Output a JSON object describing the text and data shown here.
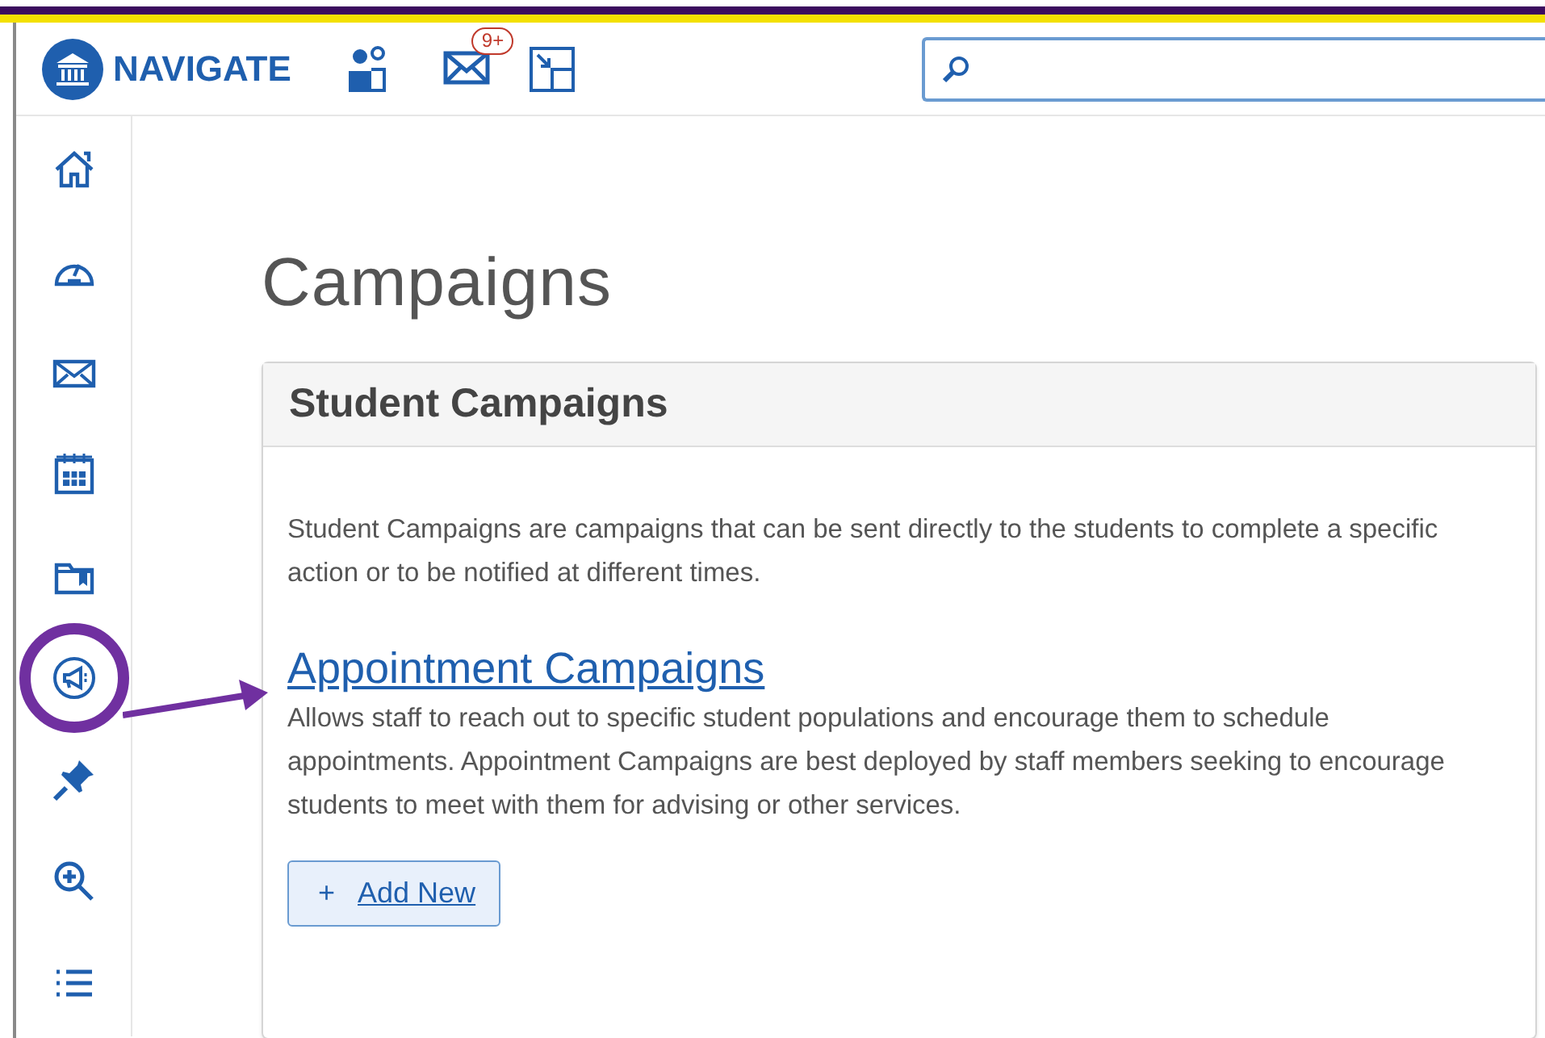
{
  "header": {
    "logo_text": "NAVIGATE",
    "message_badge": "9+"
  },
  "sidebar": {
    "items": [
      {
        "kind": "home",
        "highlighted": false
      },
      {
        "kind": "dashboard",
        "highlighted": false
      },
      {
        "kind": "mail",
        "highlighted": false
      },
      {
        "kind": "calendar",
        "highlighted": false
      },
      {
        "kind": "folder",
        "highlighted": false
      },
      {
        "kind": "campaigns",
        "highlighted": true
      },
      {
        "kind": "pin",
        "highlighted": false
      },
      {
        "kind": "search",
        "highlighted": false
      },
      {
        "kind": "list",
        "highlighted": false
      }
    ]
  },
  "page": {
    "title": "Campaigns",
    "card": {
      "title": "Student Campaigns",
      "intro": "Student Campaigns are campaigns that can be sent directly to the students to complete a specific action or to be notified at different times.",
      "section_link": "Appointment Campaigns",
      "section_text": "Allows staff to reach out to specific student populations and encourage them to schedule appointments. Appointment Campaigns are best deployed by staff members seeking to encourage students to meet with them for advising or other services.",
      "button": {
        "icon": "+",
        "label": "Add New"
      }
    }
  }
}
